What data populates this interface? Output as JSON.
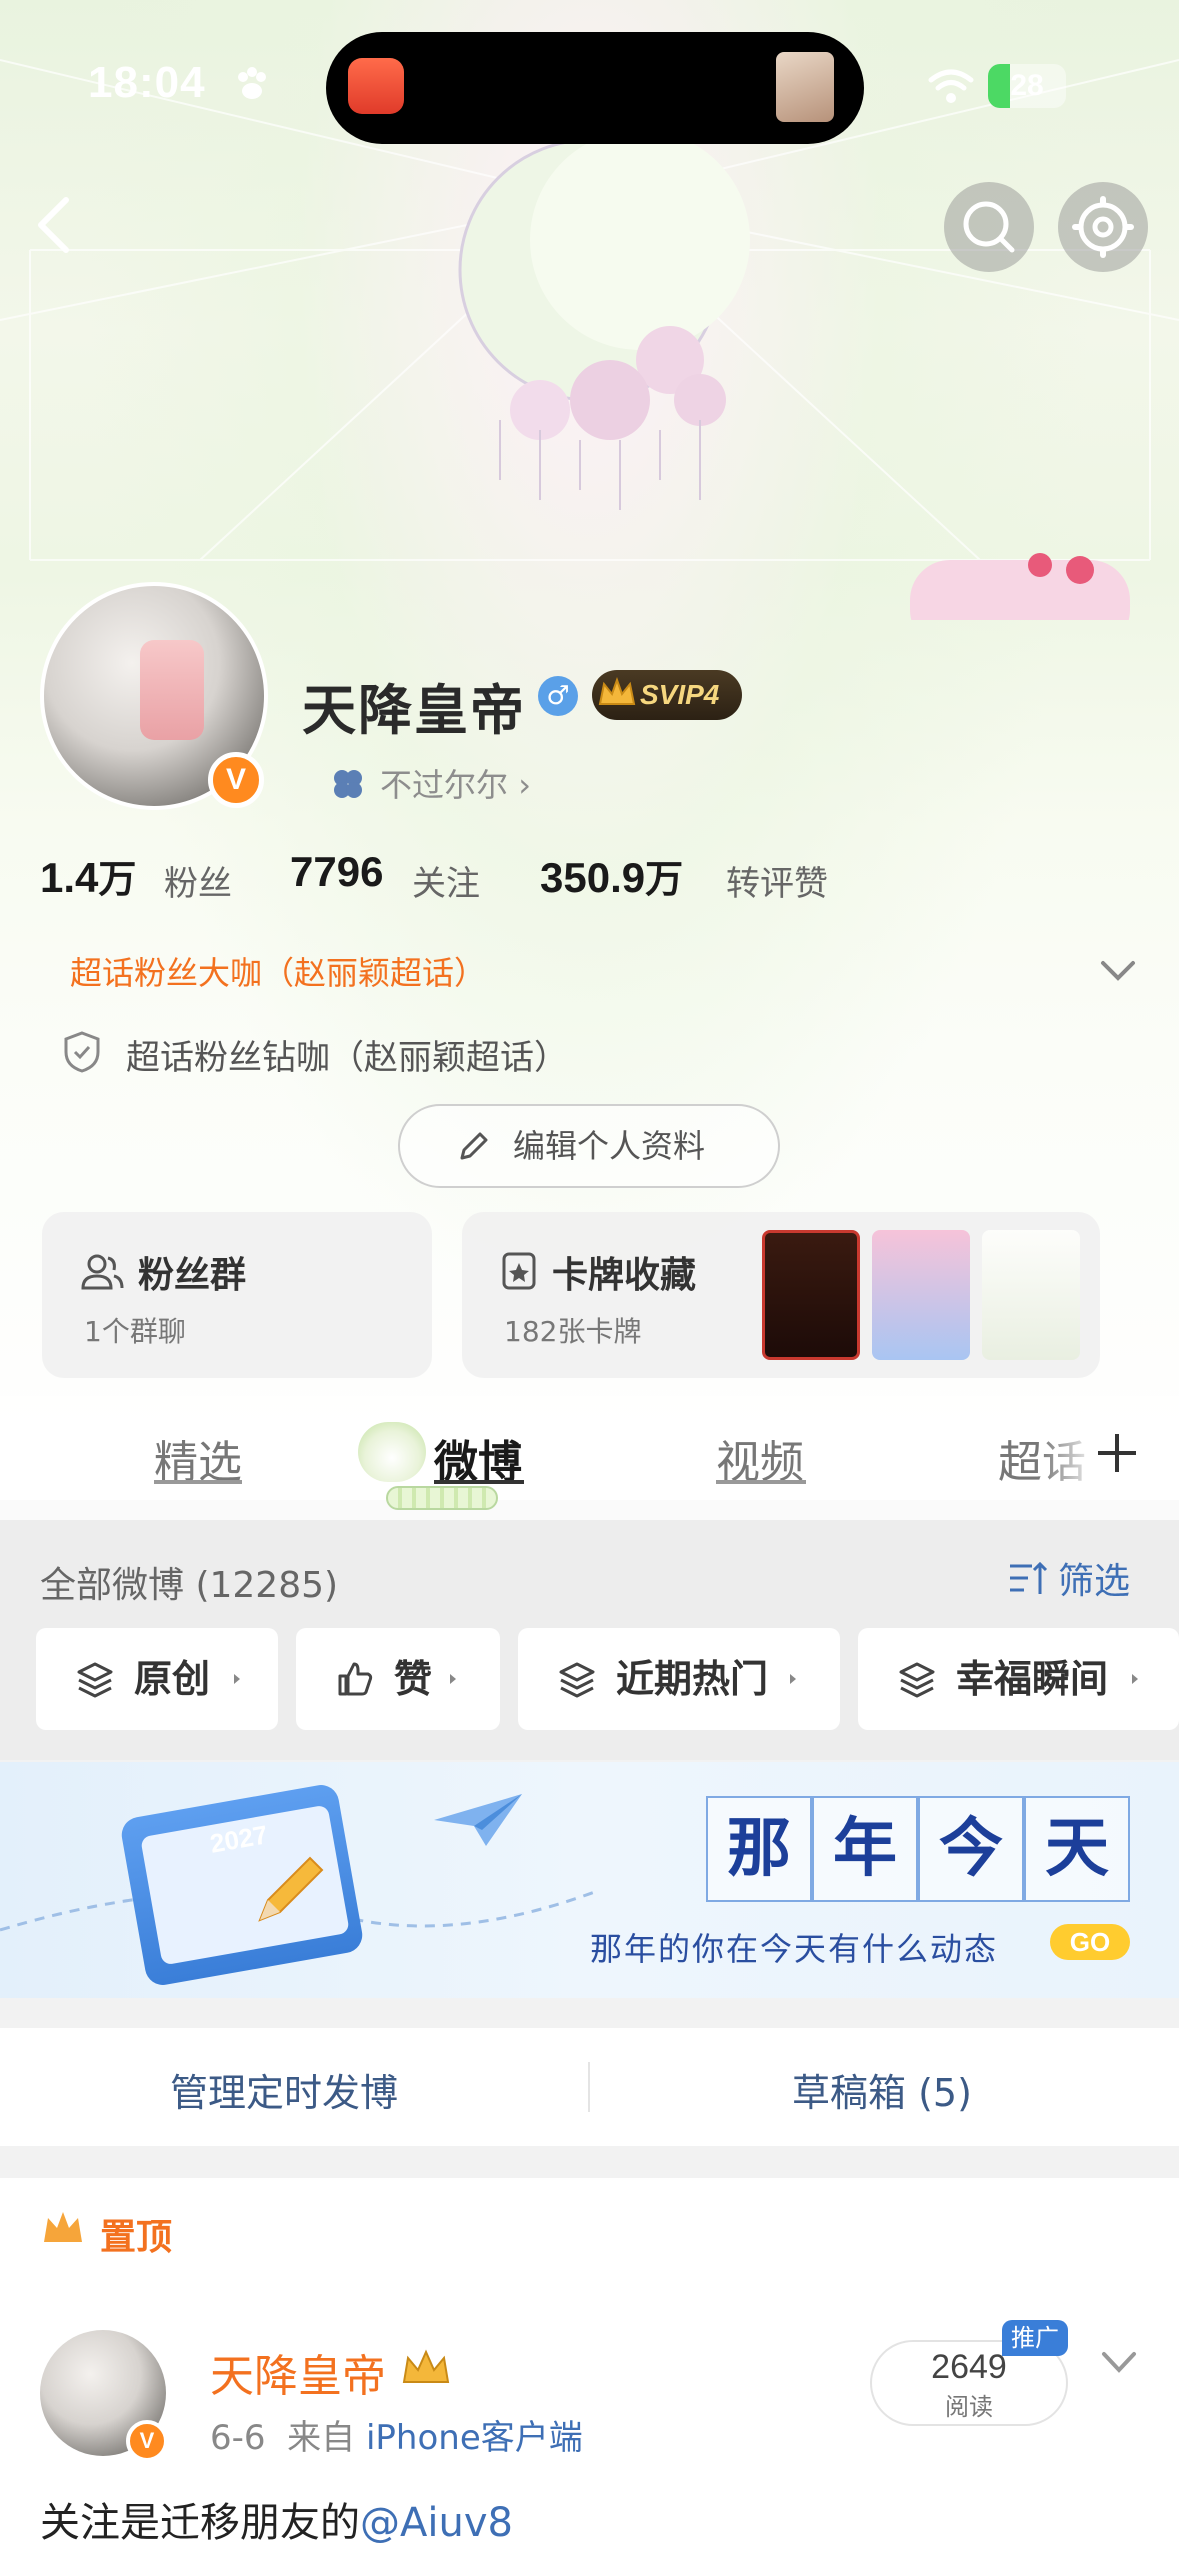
{
  "status_bar": {
    "time": "18:04",
    "battery": "28"
  },
  "profile": {
    "name": "天降皇帝",
    "vip_level": "SVIP4",
    "sub_link": "不过尔尔",
    "verified_badge": "V",
    "stats": [
      {
        "value": "1.4",
        "unit": "万",
        "label": "粉丝"
      },
      {
        "value": "7796",
        "unit": "",
        "label": "关注"
      },
      {
        "value": "350.9",
        "unit": "万",
        "label": "转评赞"
      }
    ],
    "badge_primary": "超话粉丝大咖（赵丽颖超话）",
    "badge_secondary": "超话粉丝钻咖（赵丽颖超话）",
    "edit_button": "编辑个人资料"
  },
  "cards": {
    "fans_group": {
      "title": "粉丝群",
      "sub": "1个群聊"
    },
    "card_collection": {
      "title": "卡牌收藏",
      "sub": "182张卡牌"
    }
  },
  "tabs": [
    {
      "label": "精选",
      "active": false
    },
    {
      "label": "微博",
      "active": true
    },
    {
      "label": "视频",
      "active": false
    },
    {
      "label": "超话",
      "active": false
    }
  ],
  "filter": {
    "all_weibo": "全部微博 (12285)",
    "filter_label": "筛选",
    "chips": [
      "原创",
      "赞",
      "近期热门",
      "幸福瞬间"
    ]
  },
  "banner": {
    "calendar_year": "2027",
    "title_chars": [
      "那",
      "年",
      "今",
      "天"
    ],
    "subtitle": "那年的你在今天有什么动态",
    "go": "GO"
  },
  "manage": {
    "left": "管理定时发博",
    "right": "草稿箱 (5)"
  },
  "post": {
    "pin_label": "置顶",
    "author": "天降皇帝",
    "date": "6-6",
    "source_prefix": "来自",
    "source": "iPhone客户端",
    "read_count": "2649",
    "read_label": "阅读",
    "promo": "推广",
    "text": "关注是迁移朋友的",
    "mention": "@Aiuv8"
  },
  "colors": {
    "accent_orange": "#f3711f",
    "link_blue": "#3e6fb5",
    "verified_orange": "#ff8a1f"
  }
}
